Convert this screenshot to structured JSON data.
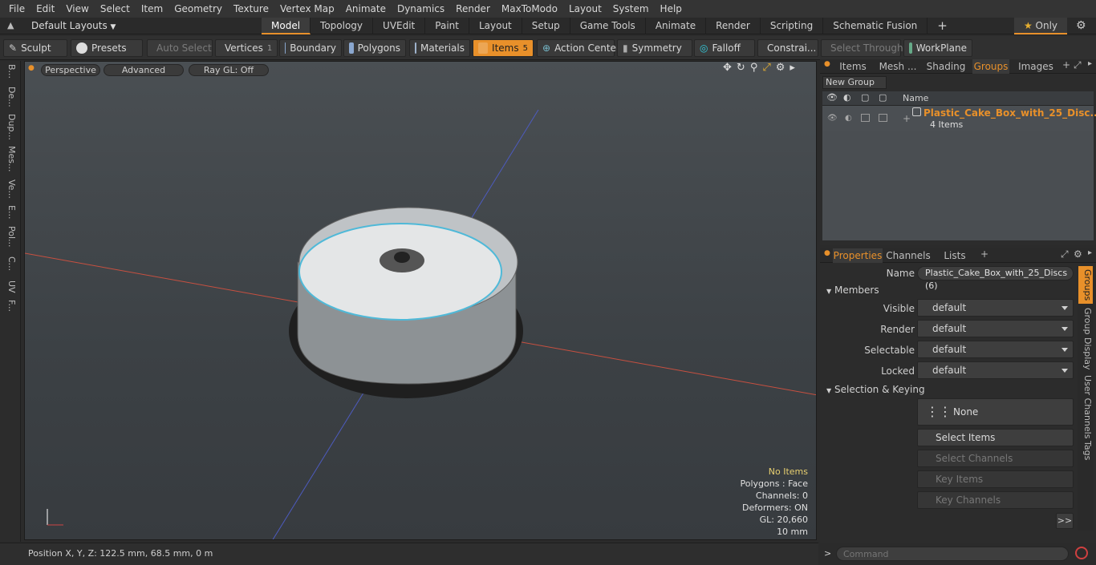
{
  "menu": [
    "File",
    "Edit",
    "View",
    "Select",
    "Item",
    "Geometry",
    "Texture",
    "Vertex Map",
    "Animate",
    "Dynamics",
    "Render",
    "MaxToModo",
    "Layout",
    "System",
    "Help"
  ],
  "layoutbar": {
    "layouts_label": "Default Layouts",
    "tabs": [
      "Model",
      "Topology",
      "UVEdit",
      "Paint",
      "Layout",
      "Setup",
      "Game Tools",
      "Animate",
      "Render",
      "Scripting",
      "Schematic Fusion"
    ],
    "add": "+",
    "only_label": "Only"
  },
  "toolbar": {
    "sculpt": "Sculpt",
    "presets": "Presets",
    "auto_select": "Auto Select",
    "vertices": "Vertices",
    "vertices_count": "1",
    "boundary": "Boundary",
    "polygons": "Polygons",
    "materials": "Materials",
    "items": "Items",
    "items_count": "5",
    "action_center": "Action Center",
    "symmetry": "Symmetry",
    "falloff": "Falloff",
    "constraints": "Constrai...",
    "select_through": "Select Through",
    "workplane": "WorkPlane"
  },
  "left_tabs": [
    "B...",
    "De...",
    "Dup...",
    "Mes...",
    "Ve...",
    "E...",
    "Pol...",
    "C...",
    "UV",
    "F..."
  ],
  "viewport": {
    "perspective": "Perspective",
    "advanced": "Advanced",
    "raygl": "Ray GL: Off",
    "hud": {
      "no_items": "No Items",
      "polygons": "Polygons : Face",
      "channels": "Channels: 0",
      "deformers": "Deformers: ON",
      "gl": "GL: 20,660",
      "scale": "10 mm"
    }
  },
  "status": {
    "position": "Position X, Y, Z:   122.5 mm, 68.5 mm, 0 m"
  },
  "groups_panel": {
    "tabs": [
      "Items",
      "Mesh ...",
      "Shading",
      "Groups",
      "Images"
    ],
    "new_group": "New Group",
    "col_name": "Name",
    "row_name": "Plastic_Cake_Box_with_25_Disc...",
    "row_count": "4 Items"
  },
  "properties": {
    "tabs": [
      "Properties",
      "Channels",
      "Lists"
    ],
    "name_label": "Name",
    "name_value": "Plastic_Cake_Box_with_25_Discs (6)",
    "members": "Members",
    "visible_label": "Visible",
    "visible_value": "default",
    "render_label": "Render",
    "render_value": "default",
    "selectable_label": "Selectable",
    "selectable_value": "default",
    "locked_label": "Locked",
    "locked_value": "default",
    "selection_keying": "Selection & Keying",
    "none": "None",
    "select_items": "Select Items",
    "select_channels": "Select Channels",
    "key_items": "Key Items",
    "key_channels": "Key Channels",
    "more": ">>",
    "side_tabs": [
      "Groups",
      "Group Display",
      "User Channels",
      "Tags"
    ]
  },
  "command": {
    "prompt": ">",
    "placeholder": "Command"
  },
  "colors": {
    "accent": "#e8902a"
  }
}
